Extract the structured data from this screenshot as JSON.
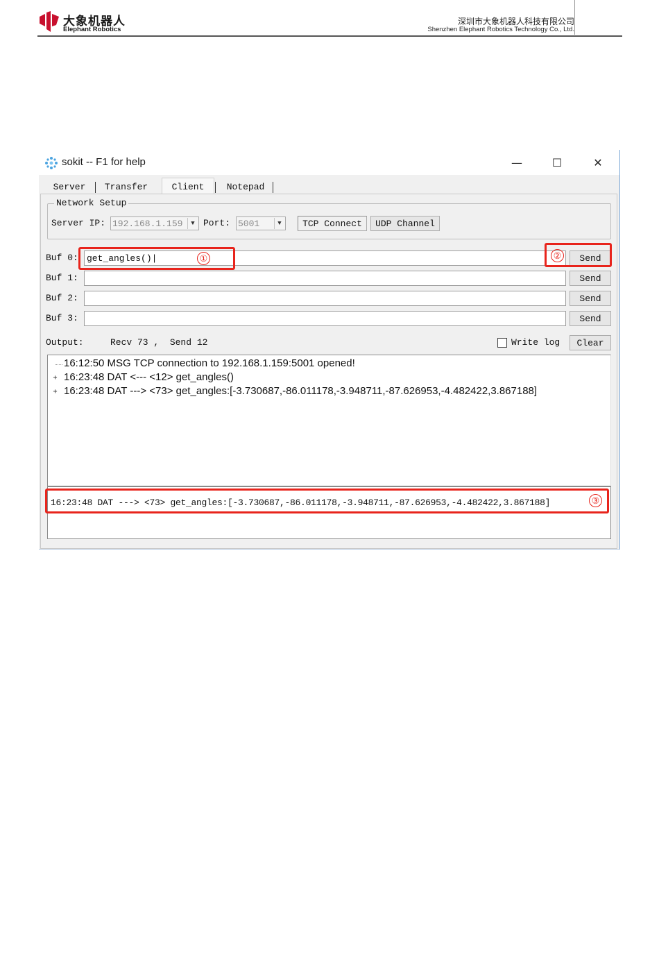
{
  "page_header": {
    "brand_cn": "大象机器人",
    "brand_en": "Elephant Robotics",
    "company_cn": "深圳市大象机器人科技有限公司",
    "company_en": "Shenzhen Elephant Robotics Technology Co., Ltd.",
    "brand_color": "#c8102e"
  },
  "window": {
    "title": "sokit -- F1 for help",
    "controls": {
      "minimize": "—",
      "maximize": "☐",
      "close": "✕"
    }
  },
  "tabs": [
    {
      "label": "Server",
      "active": false
    },
    {
      "label": "Transfer",
      "active": false
    },
    {
      "label": "Client",
      "active": true
    },
    {
      "label": "Notepad",
      "active": false
    }
  ],
  "network_setup": {
    "group_label": "Network Setup",
    "server_ip_label": "Server IP:",
    "server_ip_value": "192.168.1.159",
    "port_label": "Port:",
    "port_value": "5001",
    "tcp_connect_label": "TCP Connect",
    "udp_channel_label": "UDP Channel"
  },
  "buffers": [
    {
      "label": "Buf 0:",
      "value": "get_angles()|",
      "send_label": "Send"
    },
    {
      "label": "Buf 1:",
      "value": "",
      "send_label": "Send"
    },
    {
      "label": "Buf 2:",
      "value": "",
      "send_label": "Send"
    },
    {
      "label": "Buf 3:",
      "value": "",
      "send_label": "Send"
    }
  ],
  "output": {
    "label": "Output:",
    "counts": "Recv 73 ,  Send 12",
    "write_log_label": "Write log",
    "write_log_checked": false,
    "clear_label": "Clear",
    "log": [
      {
        "expander": "",
        "text": "16:12:50 MSG TCP connection to 192.168.1.159:5001 opened!"
      },
      {
        "expander": "+",
        "text": "16:23:48 DAT <--- <12> get_angles()"
      },
      {
        "expander": "+",
        "text": "16:23:48 DAT ---> <73> get_angles:[-3.730687,-86.011178,-3.948711,-87.626953,-4.482422,3.867188]"
      }
    ],
    "status_line": "16:23:48 DAT ---> <73> get_angles:[-3.730687,-86.011178,-3.948711,-87.626953,-4.482422,3.867188]"
  },
  "annotations": {
    "marker_1": "①",
    "marker_2": "②",
    "marker_3": "③",
    "color": "#e8241c"
  }
}
